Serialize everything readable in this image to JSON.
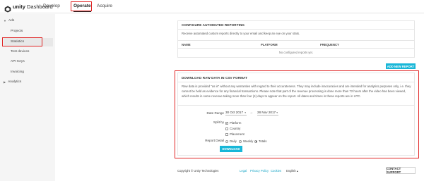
{
  "header": {
    "logo_bold": "unity",
    "logo_text": "Dashboard",
    "tabs": [
      {
        "label": "Develop"
      },
      {
        "label": "Operate"
      },
      {
        "label": "Acquire"
      }
    ]
  },
  "sidebar": {
    "ads": "Ads",
    "items": [
      "Projects",
      "Statistics",
      "Test devices",
      "API Keys",
      "Invoicing"
    ],
    "analytics": "Analytics"
  },
  "automated": {
    "title": "CONFIGURE AUTOMATED REPORTING",
    "description": "Receive automated custom reports directly to your email and keep an eye on your stats.",
    "columns": [
      "NAME",
      "PLATFORM",
      "FREQUENCY"
    ],
    "empty": "No configured reports yet.",
    "add_button": "ADD NEW REPORT"
  },
  "raw": {
    "title": "DOWNLOAD RAW DATA IN CSV FORMAT",
    "description": "Raw data is provided \"as is\" without any warranties with regard to their accurateness. They may include inaccuracies and are intended for analytics purposes only, i.e. they cannot be held as evidence for any financial transactions. Please note that part of the revenue processing is done more than 72 hours after the video has been viewed, which results in some revenue taking more than four (4) days to appear on the report. All dates and times in these reports are in UTC.",
    "date_label": "Date Range",
    "date_from": "30 Oct 2017",
    "date_to": "28 Nov 2017",
    "split_label": "Split by",
    "split_options": [
      "Platform",
      "Country",
      "Placement"
    ],
    "detail_label": "Report Detail",
    "detail_options": [
      "Daily",
      "Weekly",
      "Totals"
    ],
    "download_button": "DOWNLOAD"
  },
  "footer": {
    "copyright": "Copyright © Unity Technologies",
    "links": [
      "Legal",
      "Privacy Policy",
      "Cookies"
    ],
    "language": "English",
    "contact": "CONTACT SUPPORT"
  },
  "colors": {
    "accent": "#19b7d8",
    "highlight": "#e02424"
  }
}
